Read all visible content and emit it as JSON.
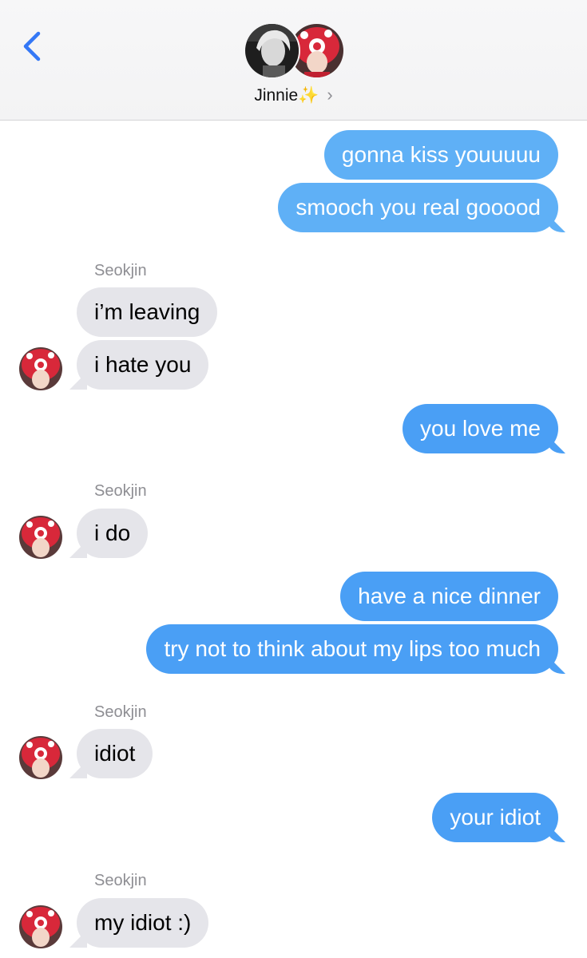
{
  "header": {
    "contact_name": "Jinnie",
    "contact_emoji": "✨",
    "chevron": "›",
    "back_icon": "chevron-left-icon",
    "accent_color": "#3478f6"
  },
  "colors": {
    "outgoing_bubble": "#4a9ff5",
    "incoming_bubble": "#e5e5ea",
    "sender_label": "#8e8e93"
  },
  "messages": [
    {
      "from": "me",
      "text": "gonna kiss youuuuu"
    },
    {
      "from": "me",
      "text": "smooch you real gooood"
    },
    {
      "from": "them",
      "sender": "Seokjin",
      "text": "i’m leaving"
    },
    {
      "from": "them",
      "text": "i hate you"
    },
    {
      "from": "me",
      "text": "you love me"
    },
    {
      "from": "them",
      "sender": "Seokjin",
      "text": "i do"
    },
    {
      "from": "me",
      "text": "have a nice dinner"
    },
    {
      "from": "me",
      "text": "try not to think about my lips too much"
    },
    {
      "from": "them",
      "sender": "Seokjin",
      "text": "idiot"
    },
    {
      "from": "me",
      "text": "your idiot"
    },
    {
      "from": "them",
      "sender": "Seokjin",
      "text": "my idiot :)"
    }
  ]
}
